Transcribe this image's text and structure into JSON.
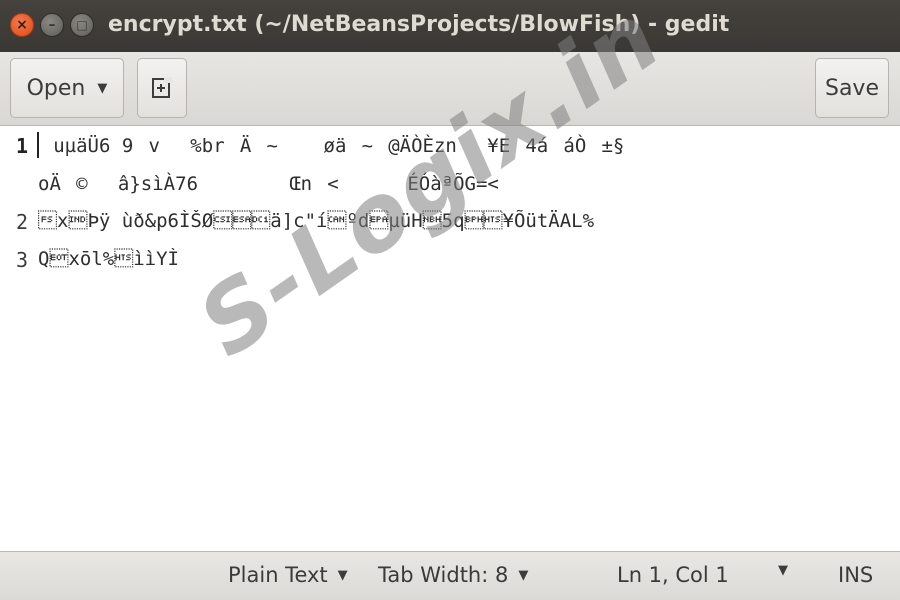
{
  "window": {
    "title": "encrypt.txt (~/NetBeansProjects/BlowFish) - gedit",
    "close_glyph": "×",
    "minimize_glyph": "–",
    "maximize_glyph": "□"
  },
  "toolbar": {
    "open_label": "Open",
    "open_caret": "▼",
    "new_tab_icon": "new-document-icon",
    "save_label": "Save"
  },
  "editor": {
    "line_numbers": [
      "1",
      "",
      "2",
      "3"
    ],
    "lines": [
      "uµäÜ6 9v\u0012%brÄ~\u0007øä\u0018~@ÄÒÈzn¥E4ááÒ±§",
      "o\fÄ©â}sìÀ76\u0007Œn\u0013<      ÉÓàªÕG=<",
      "\u001cxÞÿ ùð&p6ÌŠØ\u0011ä]c\"í\u0018ºdµüH5q¥ÕütÄAL%",
      "\fQ\u0004xōl%ììYÌ"
    ]
  },
  "watermark": {
    "text": "S-Logix.in"
  },
  "status_bar": {
    "language": "Plain Text",
    "tab_width": "Tab Width: 8",
    "position": "Ln 1, Col 1",
    "mode": "INS",
    "caret": "▼"
  }
}
